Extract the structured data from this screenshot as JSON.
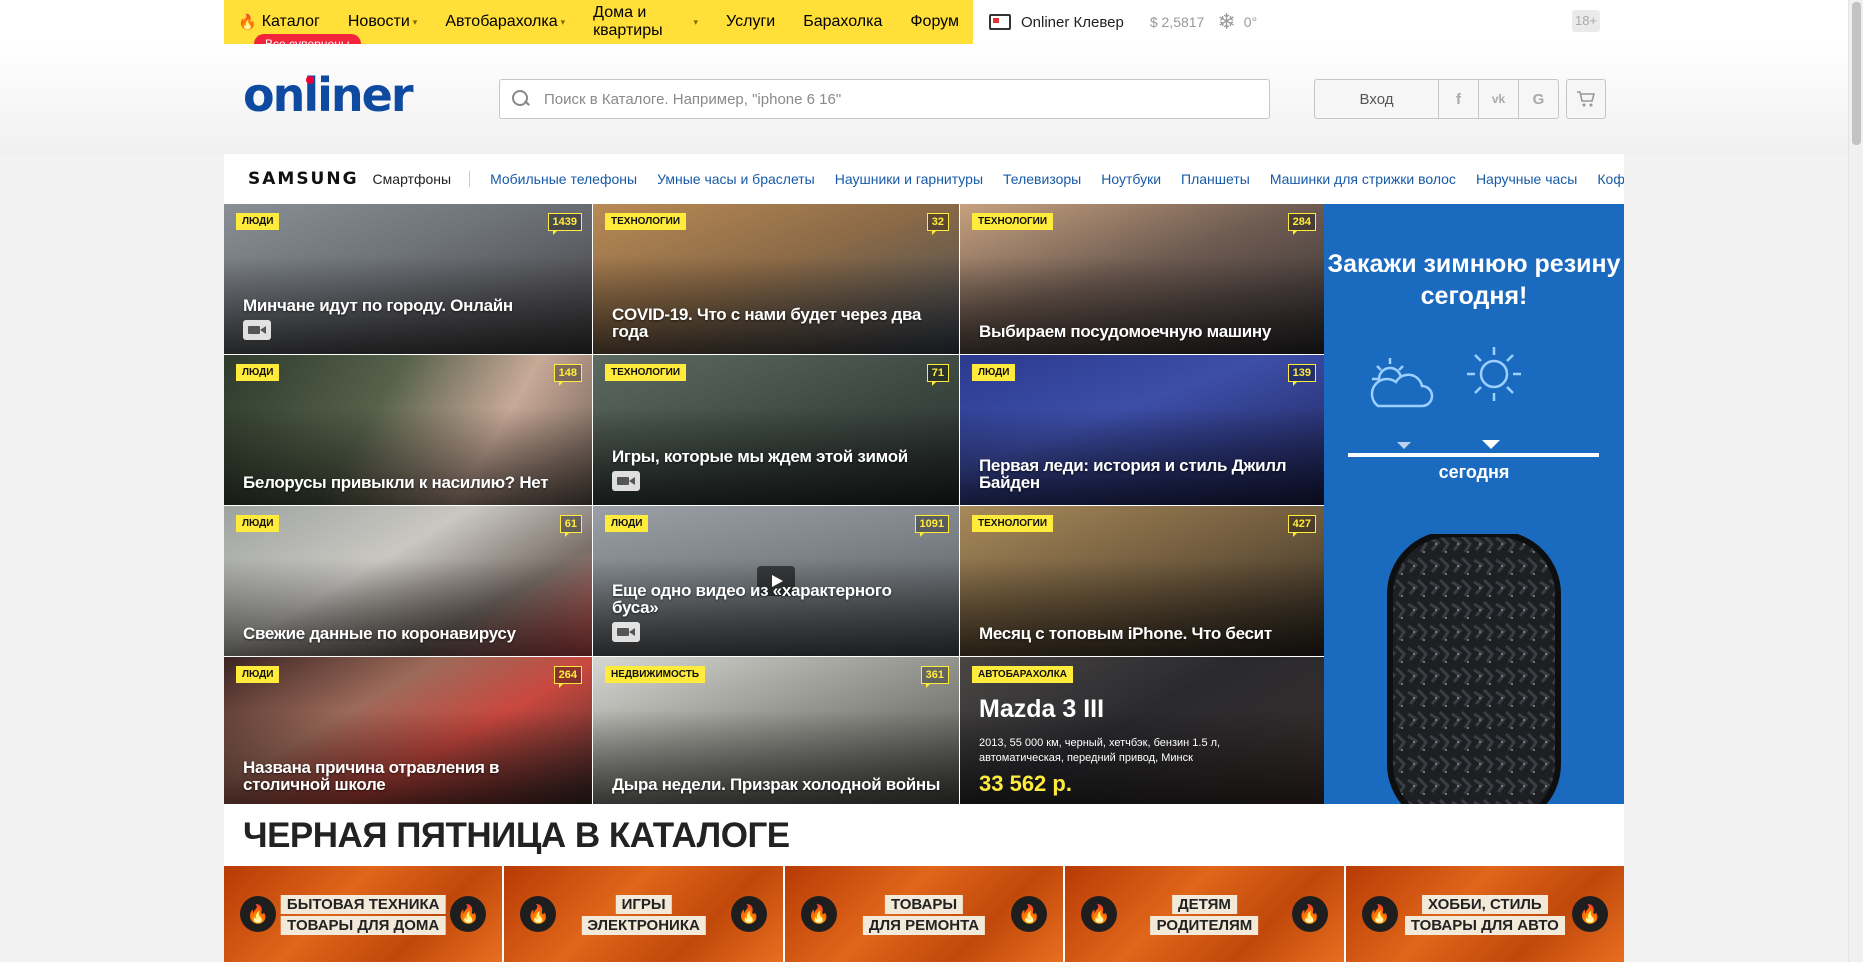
{
  "topbar": {
    "nav": [
      {
        "label": "Каталог",
        "flame": true,
        "chevron": false
      },
      {
        "label": "Новости",
        "chevron": true
      },
      {
        "label": "Автобарахолка",
        "chevron": true
      },
      {
        "label": "Дома и квартиры",
        "chevron": true
      },
      {
        "label": "Услуги",
        "chevron": false
      },
      {
        "label": "Барахолка",
        "chevron": false
      },
      {
        "label": "Форум",
        "chevron": false
      }
    ],
    "sale_badge": "Все суперцены",
    "clever": "Onliner Клевер",
    "rate": "$ 2,5817",
    "temp": "0°",
    "age": "18+"
  },
  "header": {
    "logo_a": "on",
    "logo_b": "l",
    "logo_c": "iner",
    "search_placeholder": "Поиск в Каталоге. Например, \"iphone 6 16\"",
    "login": "Вход",
    "social": [
      "f",
      "vk",
      "G"
    ]
  },
  "catbar": {
    "brand": "SAMSUNG",
    "sub": "Смартфоны",
    "links": [
      "Мобильные телефоны",
      "Умные часы и браслеты",
      "Наушники и гарнитуры",
      "Телевизоры",
      "Ноутбуки",
      "Планшеты",
      "Машинки для стрижки волос",
      "Наручные часы",
      "Кофеварки"
    ]
  },
  "news": [
    {
      "rubric": "Люди",
      "count": "1439",
      "title": "Минчане идут по городу. Онлайн",
      "video": true,
      "bg": "linear-gradient(160deg,#8a8f96 0%,#6e7379 40%,#3f3a3c 100%)"
    },
    {
      "rubric": "Технологии",
      "count": "32",
      "title": "COVID-19. Что с нами будет через два года",
      "video": false,
      "bg": "linear-gradient(160deg,#b98a55 0%,#8b6a47 45%,#3b4654 100%)"
    },
    {
      "rubric": "Технологии",
      "count": "284",
      "title": "Выбираем посудомоечную машину",
      "video": false,
      "bg": "linear-gradient(160deg,#c7a17f 0%,#6f5c52 45%,#2d2b2e 100%)"
    },
    {
      "rubric": "Люди",
      "count": "148",
      "title": "Белорусы привыкли к насилию? Нет",
      "video": false,
      "bg": "linear-gradient(120deg,#2e3a2c 0%,#55614a 40%,#c9a998 70%,#6d5e54 100%)"
    },
    {
      "rubric": "Технологии",
      "count": "71",
      "title": "Игры, которые мы ждем этой зимой",
      "video": true,
      "bg": "linear-gradient(160deg,#5d6a60 0%,#3f4a44 50%,#232928 100%)"
    },
    {
      "rubric": "Люди",
      "count": "139",
      "title": "Первая леди: история и стиль Джилл Байден",
      "video": false,
      "bg": "linear-gradient(160deg,#2a3a8e 0%,#3d4ea8 40%,#1b1f4e 100%)"
    },
    {
      "rubric": "Люди",
      "count": "61",
      "title": "Свежие данные по коронавирусу",
      "video": false,
      "bg": "linear-gradient(150deg,#9ea3a0 0%,#c9c7c2 40%,#7a6f68 70%,#d35050 100%)"
    },
    {
      "rubric": "Люди",
      "count": "1091",
      "title": "Еще одно видео из «характерного буса»",
      "video": true,
      "play": true,
      "bg": "linear-gradient(170deg,#9aa0a6 0%,#7d8388 40%,#4e5154 100%)"
    },
    {
      "rubric": "Технологии",
      "count": "427",
      "title": "Месяц с топовым iPhone. Что бесит",
      "video": false,
      "bg": "linear-gradient(160deg,#a8895a 0%,#6f5a3d 50%,#2c2620 100%)"
    },
    {
      "rubric": "Люди",
      "count": "264",
      "title": "Названа причина отравления в столичной школе",
      "video": false,
      "bg": "linear-gradient(150deg,#3a2422 0%,#9d6a5a 35%,#c9483f 60%,#3a2a2a 100%)"
    },
    {
      "rubric": "Недвижимость",
      "count": "361",
      "title": "Дыра недели. Призрак холодной войны",
      "video": false,
      "bg": "linear-gradient(160deg,#d6d6d3 0%,#9e9e98 40%,#4c4c48 100%)"
    }
  ],
  "ad_car": {
    "rubric": "Автобарахолка",
    "title": "Mazda 3 III",
    "desc": "2013, 55 000 км, черный, хетчбэк, бензин 1.5 л, автоматическая, передний привод, Минск",
    "price": "33 562 р."
  },
  "banner": {
    "title": "Закажи зимнюю резину сегодня!",
    "today": "сегодня"
  },
  "black_friday": {
    "title": "ЧЕРНАЯ ПЯТНИЦА В КАТАЛОГЕ",
    "cards": [
      [
        "БЫТОВАЯ ТЕХНИКА",
        "ТОВАРЫ ДЛЯ ДОМА"
      ],
      [
        "ИГРЫ",
        "ЭЛЕКТРОНИКА"
      ],
      [
        "ТОВАРЫ",
        "ДЛЯ РЕМОНТА"
      ],
      [
        "ДЕТЯМ",
        "РОДИТЕЛЯМ"
      ],
      [
        "ХОББИ, СТИЛЬ",
        "ТОВАРЫ ДЛЯ АВТО"
      ]
    ]
  },
  "colors": {
    "brand_yellow": "#ffdf38",
    "brand_blue": "#0f4aa1",
    "link": "#175aa8",
    "badge_red": "#f2253a"
  }
}
